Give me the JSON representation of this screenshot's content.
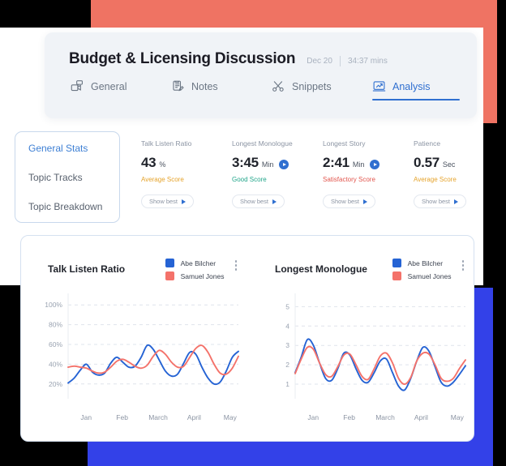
{
  "background": {
    "coral": "#ef7363",
    "blue": "#3341e8",
    "black": "#000000",
    "white": "#ffffff"
  },
  "header": {
    "title": "Budget & Licensing Discussion",
    "date": "Dec 20",
    "duration": "34:37 mins",
    "tabs": [
      {
        "label": "General",
        "icon": "video-camera-icon",
        "active": false
      },
      {
        "label": "Notes",
        "icon": "notes-icon",
        "active": false
      },
      {
        "label": "Snippets",
        "icon": "scissors-icon",
        "active": false
      },
      {
        "label": "Analysis",
        "icon": "analysis-chart-icon",
        "active": true
      }
    ]
  },
  "sidebar": {
    "items": [
      {
        "label": "General Stats",
        "active": true
      },
      {
        "label": "Topic Tracks",
        "active": false
      },
      {
        "label": "Topic Breakdown",
        "active": false
      }
    ]
  },
  "stats": [
    {
      "label": "Talk Listen Ratio",
      "value": "43",
      "unit": "%",
      "has_play": false,
      "score": "Average Score",
      "score_class": "score-average",
      "button": "Show best"
    },
    {
      "label": "Longest Monologue",
      "value": "3:45",
      "unit": "Min",
      "has_play": true,
      "score": "Good Score",
      "score_class": "score-good",
      "button": "Show best"
    },
    {
      "label": "Longest Story",
      "value": "2:41",
      "unit": "Min",
      "has_play": true,
      "score": "Satisfactory Score",
      "score_class": "score-satisfactory",
      "button": "Show best"
    },
    {
      "label": "Patience",
      "value": "0.57",
      "unit": "Sec",
      "has_play": false,
      "score": "Average Score",
      "score_class": "score-average",
      "button": "Show best"
    }
  ],
  "colors": {
    "series_blue": "#2563d4",
    "series_red": "#f4726a",
    "accent": "#2f6fd0"
  },
  "chart_data": [
    {
      "type": "line",
      "title": "Talk Listen Ratio",
      "xlabel": "",
      "ylabel": "",
      "ylim": [
        10,
        110
      ],
      "yticks": [
        "20%",
        "40%",
        "60%",
        "80%",
        "100%"
      ],
      "ytick_values": [
        20,
        40,
        60,
        80,
        100
      ],
      "categories": [
        "Jan",
        "Feb",
        "March",
        "April",
        "May"
      ],
      "grid": true,
      "legend_position": "top-right",
      "menu_icon": "kebab-menu-icon",
      "series": [
        {
          "name": "Abe Bilcher",
          "color": "#2563d4",
          "values": [
            21,
            26,
            34,
            40,
            32,
            29,
            31,
            41,
            47,
            42,
            37,
            38,
            47,
            59,
            55,
            44,
            33,
            28,
            30,
            41,
            52,
            50,
            37,
            26,
            20,
            22,
            33,
            47,
            53
          ]
        },
        {
          "name": "Samuel Jones",
          "color": "#f4726a",
          "values": [
            37,
            38,
            37,
            36,
            33,
            31,
            32,
            37,
            43,
            45,
            42,
            38,
            36,
            39,
            48,
            54,
            50,
            42,
            37,
            38,
            47,
            56,
            59,
            52,
            40,
            31,
            30,
            36,
            48
          ]
        }
      ]
    },
    {
      "type": "line",
      "title": "Longest Monologue",
      "xlabel": "",
      "ylabel": "",
      "ylim": [
        0.5,
        5.6
      ],
      "yticks": [
        "1",
        "2",
        "3",
        "4",
        "5"
      ],
      "ytick_values": [
        1,
        2,
        3,
        4,
        5
      ],
      "categories": [
        "Jan",
        "Feb",
        "March",
        "April",
        "May"
      ],
      "grid": true,
      "legend_position": "top-right",
      "menu_icon": "kebab-menu-icon",
      "series": [
        {
          "name": "Abe Bilcher",
          "color": "#2563d4",
          "values": [
            1.6,
            2.4,
            3.3,
            3.0,
            2.1,
            1.3,
            1.2,
            1.8,
            2.6,
            2.5,
            1.8,
            1.2,
            1.1,
            1.6,
            2.2,
            2.3,
            1.6,
            0.9,
            0.7,
            1.3,
            2.2,
            2.9,
            2.7,
            1.9,
            1.1,
            0.9,
            1.1,
            1.5,
            1.95
          ]
        },
        {
          "name": "Samuel Jones",
          "color": "#f4726a",
          "values": [
            1.55,
            2.3,
            2.9,
            2.8,
            2.1,
            1.5,
            1.4,
            1.9,
            2.5,
            2.55,
            2.0,
            1.4,
            1.25,
            1.8,
            2.45,
            2.6,
            2.1,
            1.3,
            1.0,
            1.35,
            2.2,
            2.6,
            2.55,
            2.0,
            1.3,
            1.15,
            1.3,
            1.8,
            2.25
          ]
        }
      ]
    }
  ]
}
